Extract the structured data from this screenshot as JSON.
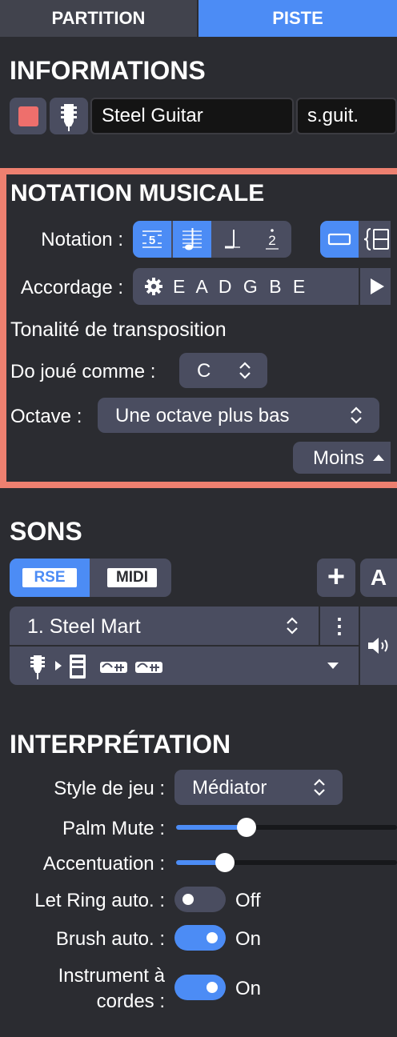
{
  "tabs": {
    "partition": "PARTITION",
    "piste": "PISTE"
  },
  "informations": {
    "title": "INFORMATIONS",
    "track_color": "#ee6f6c",
    "track_name": "Steel Guitar",
    "short_name": "s.guit."
  },
  "notation": {
    "title": "NOTATION MUSICALE",
    "highlight_color": "#ee8070",
    "notation_label": "Notation :",
    "tab_number": "5",
    "slash_number": "2",
    "tuning_label": "Accordage :",
    "tuning_value": "E A D G B E",
    "transposition_title": "Tonalité de transposition",
    "played_as_label": "Do joué comme :",
    "played_as_value": "C",
    "octave_label": "Octave :",
    "octave_value": "Une octave plus bas",
    "less_button": "Moins"
  },
  "sons": {
    "title": "SONS",
    "rse_label": "RSE",
    "midi_label": "MIDI",
    "add_label": "+",
    "auto_label": "A",
    "preset": "1. Steel Mart",
    "more": "⋮"
  },
  "interpretation": {
    "title": "INTERPRÉTATION",
    "style_label": "Style de jeu :",
    "style_value": "Médiator",
    "palm_mute_label": "Palm Mute :",
    "palm_mute_level": 0.32,
    "accent_label": "Accentuation :",
    "accent_level": 0.22,
    "let_ring_label": "Let Ring auto. :",
    "let_ring_state": "Off",
    "brush_label": "Brush auto. :",
    "brush_state": "On",
    "string_label_1": "Instrument à",
    "string_label_2": "cordes :",
    "string_state": "On"
  },
  "colors": {
    "accent": "#4c8cf5",
    "panel": "#2b2c31",
    "button": "#4a4d60",
    "field": "#141414"
  }
}
